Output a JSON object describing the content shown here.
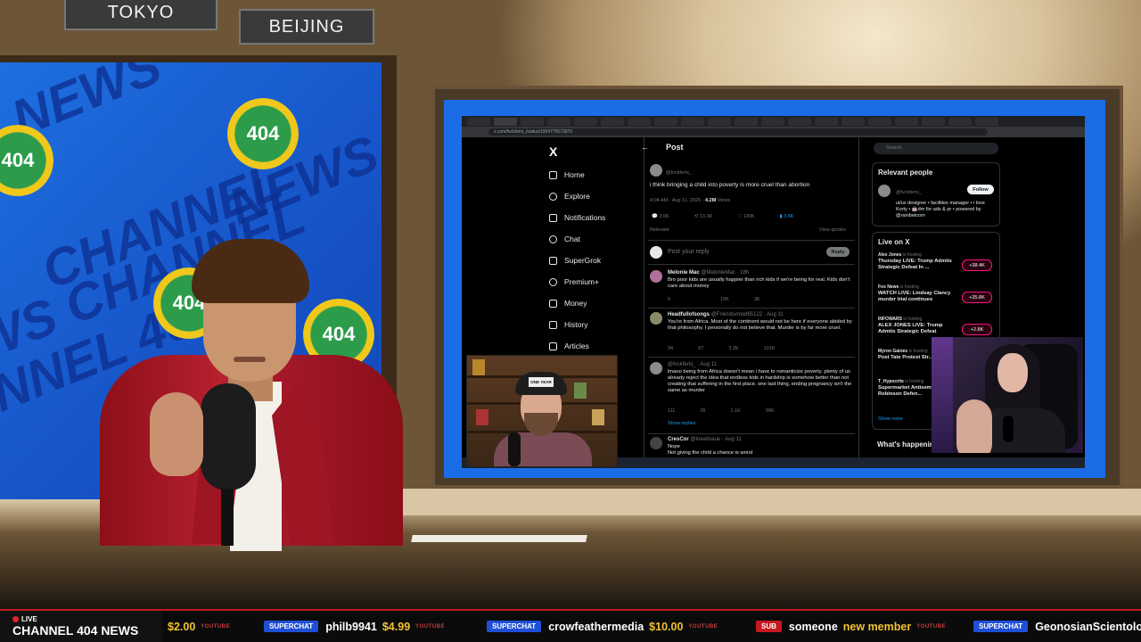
{
  "studio": {
    "city_signs": [
      "TOKYO",
      "BEIJING"
    ],
    "background_words": [
      "NEWS",
      "CHANNEL",
      "NEWS CH",
      "ANNEL 404 NE",
      "WS CHANNEL",
      "NEWS",
      "CHANNEL"
    ],
    "logo_text": "404"
  },
  "browser": {
    "url": "x.com/fvckfemi_/status/1954775073070"
  },
  "x_nav": {
    "logo": "X",
    "items": [
      "Home",
      "Explore",
      "Notifications",
      "Chat",
      "SuperGrok",
      "Premium+",
      "Money",
      "History",
      "Articles"
    ]
  },
  "post": {
    "header": "Post",
    "author_handle": "@fvckfemi_",
    "text": "i think bringing a child into poverty is more cruel than abortion",
    "meta": "4:04 AM · Aug 11, 2025 · ",
    "views": "4.2M",
    "views_label": " Views",
    "stats": [
      "3.6K",
      "13.3K",
      "130K",
      "3.6K"
    ],
    "relevant_label": "Relevant",
    "view_quotes": "View quotes",
    "reply_placeholder": "Post your reply",
    "reply_button": "Reply"
  },
  "replies": [
    {
      "name": "Melonie Mac",
      "handle": "@MelonieMac · 18h",
      "text": "Bro poor kids are usually happier than rich kids if we're being for real. Kids don't care about money",
      "stats": [
        "5",
        "",
        "10K",
        "3K"
      ]
    },
    {
      "name": "Headfullofsongs",
      "handle": "@Friendsvmod65122 · Aug 11",
      "text": "You're from Africa. Most of the continent would not be here if everyone abided by that philosophy. I personally do not believe that. Murder is by far more cruel.",
      "stats": [
        "34",
        "67",
        "3.2K",
        "101K"
      ]
    },
    {
      "name": "",
      "handle": "@fvckfemi_ · Aug 11",
      "text": "lmaoo being from Africa doesn't mean i have to romanticize poverty. plenty of us already reject the idea that endless kids in hardship is somehow better than not creating that suffering in the first place. one last thing, ending pregnancy isn't the same as murder",
      "stats": [
        "111",
        "26",
        "1.1K",
        "99K"
      ],
      "show_replies": "Show replies"
    },
    {
      "name": "CresCor",
      "handle": "@kreativaue · Aug 11",
      "text": "Nope",
      "text2": "Not giving the child a chance is worst"
    }
  ],
  "sidebar": {
    "search_placeholder": "Search",
    "relevant_title": "Relevant people",
    "person_handle": "@fvckfemi_",
    "person_bio": "ui/ux designer • facilities manager • i love Korty • 🤖dm for ads & pr • powered by @rainbetcom",
    "follow_label": "Follow",
    "live_title": "Live on X",
    "live": [
      {
        "source": "Alex Jones",
        "status": "is hosting",
        "headline": "Thursday LIVE: Trump Admits Strategic Defeat In ...",
        "count": "+38.4K"
      },
      {
        "source": "Fox News",
        "status": "is hosting",
        "headline": "WATCH LIVE: Lindsay Clancy murder trial continues",
        "count": "+35.8K"
      },
      {
        "source": "INFOWARS",
        "status": "is hosting",
        "headline": "ALEX JONES LIVE: Trump Admits Strategic Defeat",
        "count": "+2.8K"
      },
      {
        "source": "Myron Gaines",
        "status": "is hosting",
        "headline": "Post Tate Protest Str...",
        "count": ""
      },
      {
        "source": "T_Hypocrite",
        "status": "is hosting",
        "headline": "Supermarket Antisem... Tyler Robinson Defen...",
        "count": ""
      }
    ],
    "show_more": "Show more",
    "whats_happening": "What's happening"
  },
  "cam1": {
    "cap_text": "ONE YEAR"
  },
  "ticker": {
    "live_label": "LIVE",
    "channel_name": "CHANNEL 404 NEWS",
    "items": [
      {
        "badge": "",
        "name": "",
        "amount": "$2.00",
        "yt": "YOUTUBE"
      },
      {
        "badge": "SUPERCHAT",
        "name": "philb9941",
        "amount": "$4.99",
        "yt": "YOUTUBE"
      },
      {
        "badge": "SUPERCHAT",
        "name": "crowfeathermedia",
        "amount": "$10.00",
        "yt": "YOUTUBE"
      },
      {
        "badge": "SUB",
        "name": "someone",
        "amount": "new member",
        "yt": "YOUTUBE"
      },
      {
        "badge": "SUPERCHAT",
        "name": "GeonosianScientolo",
        "amount": "",
        "yt": ""
      }
    ]
  }
}
